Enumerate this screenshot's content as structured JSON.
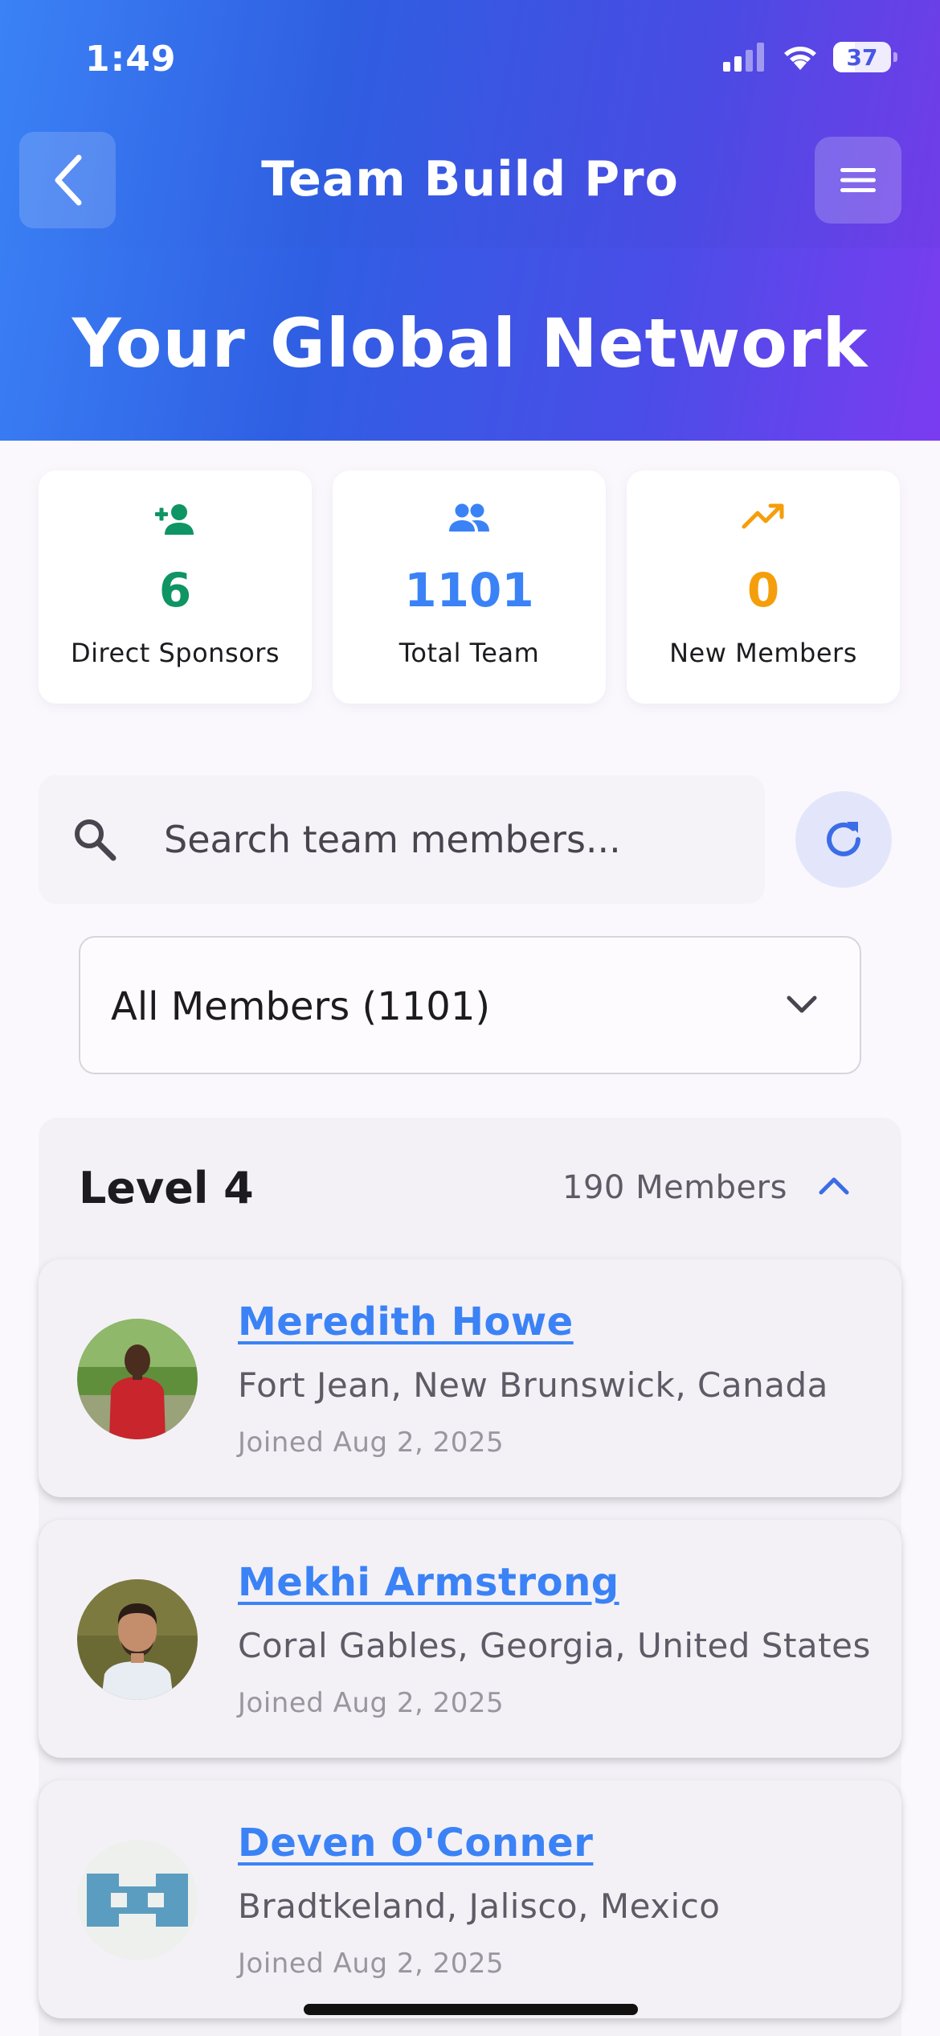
{
  "status_bar": {
    "time": "1:49",
    "battery": "37"
  },
  "header": {
    "app_title": "Team Build Pro",
    "hero_title": "Your Global Network"
  },
  "stats": [
    {
      "value": "6",
      "label": "Direct Sponsors",
      "icon": "person-add-icon",
      "color": "#0f9464"
    },
    {
      "value": "1101",
      "label": "Total Team",
      "icon": "group-icon",
      "color": "#3b82f6"
    },
    {
      "value": "0",
      "label": "New Members",
      "icon": "trending-up-icon",
      "color": "#f59e0b"
    }
  ],
  "search": {
    "placeholder": "Search team members..."
  },
  "filter": {
    "selected": "All Members (1101)"
  },
  "level": {
    "title": "Level 4",
    "count": "190 Members"
  },
  "members": [
    {
      "name": "Meredith Howe",
      "location": "Fort Jean, New Brunswick, Canada",
      "joined": "Joined Aug 2, 2025"
    },
    {
      "name": "Mekhi Armstrong",
      "location": "Coral Gables, Georgia, United States",
      "joined": "Joined Aug 2, 2025"
    },
    {
      "name": "Deven O'Conner",
      "location": "Bradtkeland, Jalisco, Mexico",
      "joined": "Joined Aug 2, 2025"
    }
  ],
  "colors": {
    "accent": "#3b82f6",
    "header_gradient_start": "#3b82f6",
    "header_gradient_end": "#7b3cf0"
  }
}
